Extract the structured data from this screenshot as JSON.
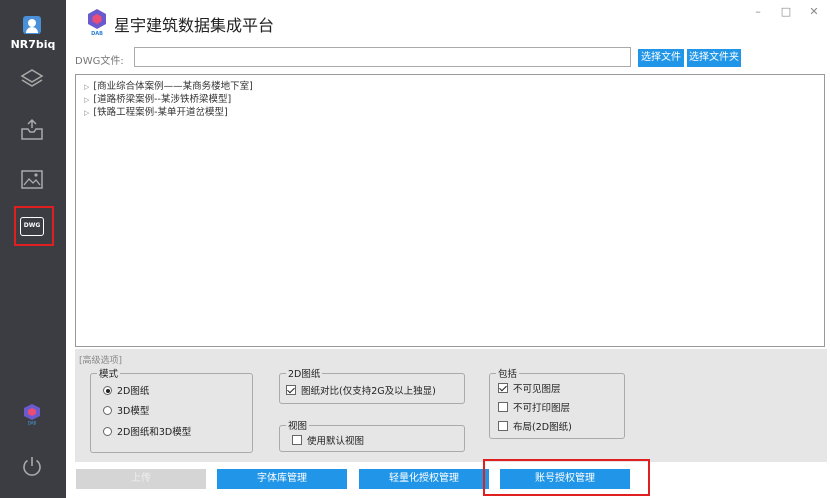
{
  "sidebar": {
    "username": "NR7biq",
    "icons": [
      "user-icon",
      "layers-icon",
      "inbox-icon",
      "image-icon",
      "dwg-icon",
      "dab-logo-icon",
      "power-icon"
    ],
    "dwg_icon_text": "DWG",
    "dab_text": "DAB"
  },
  "header": {
    "title": "星宇建筑数据集成平台",
    "logo_text": "DAB",
    "window_controls": {
      "minimize": "–",
      "maximize": "□",
      "close": "✕"
    }
  },
  "file_row": {
    "label": "DWG文件:",
    "value": "",
    "select_file": "选择文件",
    "select_folder": "选择文件夹"
  },
  "tree": {
    "items": [
      "[商业综合体案例——某商务楼地下室]",
      "[道路桥梁案例--某涉铁桥梁模型]",
      "[铁路工程案例-某单开道岔模型]"
    ]
  },
  "advanced": {
    "label": "[高级选项]",
    "mode": {
      "title": "模式",
      "options": [
        {
          "label": "2D图纸",
          "selected": true
        },
        {
          "label": "3D模型",
          "selected": false
        },
        {
          "label": "2D图纸和3D模型",
          "selected": false
        }
      ]
    },
    "drawing2d": {
      "title": "2D图纸",
      "compare_label": "图纸对比(仅支持2G及以上独显)",
      "compare_checked": true
    },
    "view": {
      "title": "视图",
      "default_view_label": "使用默认视图",
      "default_view_checked": false
    },
    "include": {
      "title": "包括",
      "options": [
        {
          "label": "不可见图层",
          "checked": true
        },
        {
          "label": "不可打印图层",
          "checked": false
        },
        {
          "label": "布局(2D图纸)",
          "checked": false
        }
      ]
    }
  },
  "actions": {
    "upload": "上传",
    "font_manage": "字体库管理",
    "light_auth_manage": "轻量化授权管理",
    "account_auth_manage": "账号授权管理"
  },
  "colors": {
    "sidebar_bg": "#3c3d43",
    "accent_blue": "#2196e8",
    "highlight_red": "#e02020",
    "panel_gray": "#e6e6e6"
  }
}
